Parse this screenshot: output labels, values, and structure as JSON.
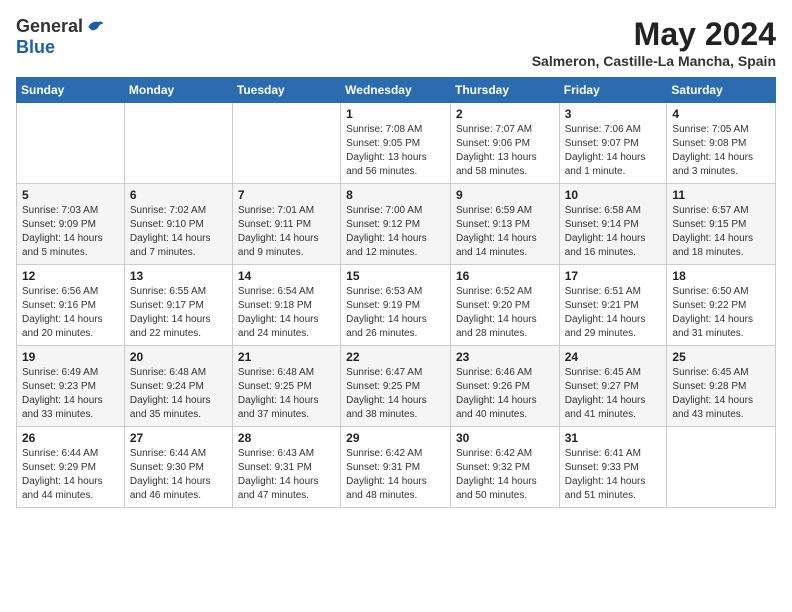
{
  "header": {
    "logo_general": "General",
    "logo_blue": "Blue",
    "month_title": "May 2024",
    "location": "Salmeron, Castille-La Mancha, Spain"
  },
  "weekdays": [
    "Sunday",
    "Monday",
    "Tuesday",
    "Wednesday",
    "Thursday",
    "Friday",
    "Saturday"
  ],
  "weeks": [
    [
      {
        "day": "",
        "info": ""
      },
      {
        "day": "",
        "info": ""
      },
      {
        "day": "",
        "info": ""
      },
      {
        "day": "1",
        "info": "Sunrise: 7:08 AM\nSunset: 9:05 PM\nDaylight: 13 hours\nand 56 minutes."
      },
      {
        "day": "2",
        "info": "Sunrise: 7:07 AM\nSunset: 9:06 PM\nDaylight: 13 hours\nand 58 minutes."
      },
      {
        "day": "3",
        "info": "Sunrise: 7:06 AM\nSunset: 9:07 PM\nDaylight: 14 hours\nand 1 minute."
      },
      {
        "day": "4",
        "info": "Sunrise: 7:05 AM\nSunset: 9:08 PM\nDaylight: 14 hours\nand 3 minutes."
      }
    ],
    [
      {
        "day": "5",
        "info": "Sunrise: 7:03 AM\nSunset: 9:09 PM\nDaylight: 14 hours\nand 5 minutes."
      },
      {
        "day": "6",
        "info": "Sunrise: 7:02 AM\nSunset: 9:10 PM\nDaylight: 14 hours\nand 7 minutes."
      },
      {
        "day": "7",
        "info": "Sunrise: 7:01 AM\nSunset: 9:11 PM\nDaylight: 14 hours\nand 9 minutes."
      },
      {
        "day": "8",
        "info": "Sunrise: 7:00 AM\nSunset: 9:12 PM\nDaylight: 14 hours\nand 12 minutes."
      },
      {
        "day": "9",
        "info": "Sunrise: 6:59 AM\nSunset: 9:13 PM\nDaylight: 14 hours\nand 14 minutes."
      },
      {
        "day": "10",
        "info": "Sunrise: 6:58 AM\nSunset: 9:14 PM\nDaylight: 14 hours\nand 16 minutes."
      },
      {
        "day": "11",
        "info": "Sunrise: 6:57 AM\nSunset: 9:15 PM\nDaylight: 14 hours\nand 18 minutes."
      }
    ],
    [
      {
        "day": "12",
        "info": "Sunrise: 6:56 AM\nSunset: 9:16 PM\nDaylight: 14 hours\nand 20 minutes."
      },
      {
        "day": "13",
        "info": "Sunrise: 6:55 AM\nSunset: 9:17 PM\nDaylight: 14 hours\nand 22 minutes."
      },
      {
        "day": "14",
        "info": "Sunrise: 6:54 AM\nSunset: 9:18 PM\nDaylight: 14 hours\nand 24 minutes."
      },
      {
        "day": "15",
        "info": "Sunrise: 6:53 AM\nSunset: 9:19 PM\nDaylight: 14 hours\nand 26 minutes."
      },
      {
        "day": "16",
        "info": "Sunrise: 6:52 AM\nSunset: 9:20 PM\nDaylight: 14 hours\nand 28 minutes."
      },
      {
        "day": "17",
        "info": "Sunrise: 6:51 AM\nSunset: 9:21 PM\nDaylight: 14 hours\nand 29 minutes."
      },
      {
        "day": "18",
        "info": "Sunrise: 6:50 AM\nSunset: 9:22 PM\nDaylight: 14 hours\nand 31 minutes."
      }
    ],
    [
      {
        "day": "19",
        "info": "Sunrise: 6:49 AM\nSunset: 9:23 PM\nDaylight: 14 hours\nand 33 minutes."
      },
      {
        "day": "20",
        "info": "Sunrise: 6:48 AM\nSunset: 9:24 PM\nDaylight: 14 hours\nand 35 minutes."
      },
      {
        "day": "21",
        "info": "Sunrise: 6:48 AM\nSunset: 9:25 PM\nDaylight: 14 hours\nand 37 minutes."
      },
      {
        "day": "22",
        "info": "Sunrise: 6:47 AM\nSunset: 9:25 PM\nDaylight: 14 hours\nand 38 minutes."
      },
      {
        "day": "23",
        "info": "Sunrise: 6:46 AM\nSunset: 9:26 PM\nDaylight: 14 hours\nand 40 minutes."
      },
      {
        "day": "24",
        "info": "Sunrise: 6:45 AM\nSunset: 9:27 PM\nDaylight: 14 hours\nand 41 minutes."
      },
      {
        "day": "25",
        "info": "Sunrise: 6:45 AM\nSunset: 9:28 PM\nDaylight: 14 hours\nand 43 minutes."
      }
    ],
    [
      {
        "day": "26",
        "info": "Sunrise: 6:44 AM\nSunset: 9:29 PM\nDaylight: 14 hours\nand 44 minutes."
      },
      {
        "day": "27",
        "info": "Sunrise: 6:44 AM\nSunset: 9:30 PM\nDaylight: 14 hours\nand 46 minutes."
      },
      {
        "day": "28",
        "info": "Sunrise: 6:43 AM\nSunset: 9:31 PM\nDaylight: 14 hours\nand 47 minutes."
      },
      {
        "day": "29",
        "info": "Sunrise: 6:42 AM\nSunset: 9:31 PM\nDaylight: 14 hours\nand 48 minutes."
      },
      {
        "day": "30",
        "info": "Sunrise: 6:42 AM\nSunset: 9:32 PM\nDaylight: 14 hours\nand 50 minutes."
      },
      {
        "day": "31",
        "info": "Sunrise: 6:41 AM\nSunset: 9:33 PM\nDaylight: 14 hours\nand 51 minutes."
      },
      {
        "day": "",
        "info": ""
      }
    ]
  ]
}
